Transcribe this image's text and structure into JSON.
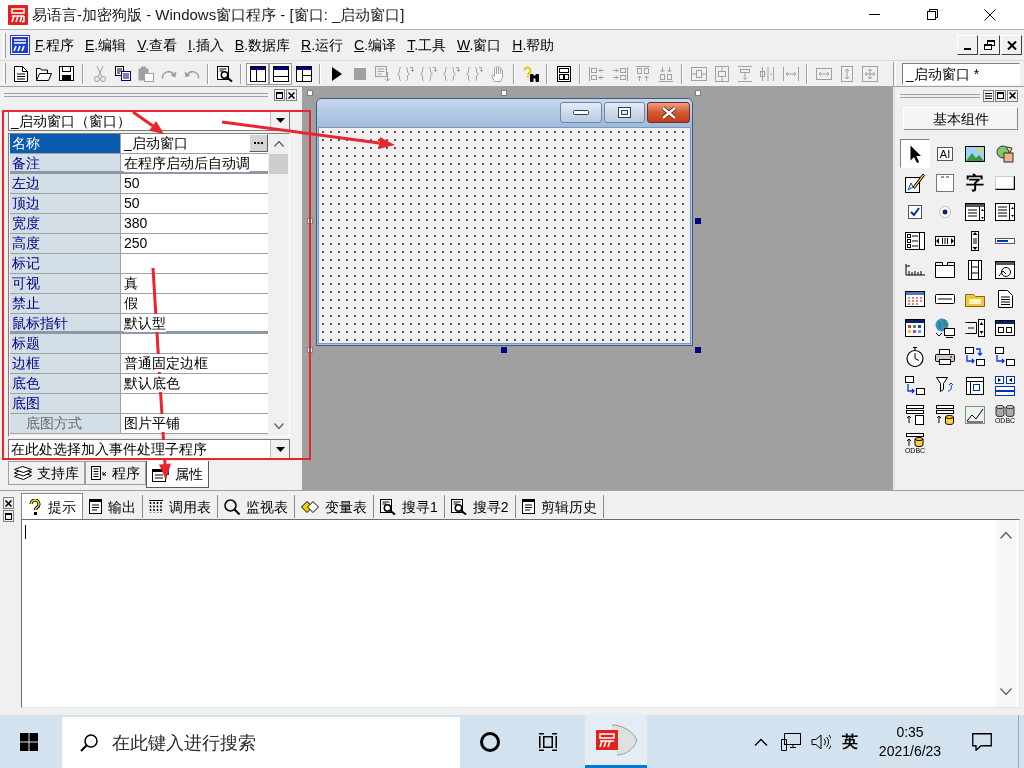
{
  "window": {
    "title": "易语言-加密狗版 - Windows窗口程序 - [窗口: _启动窗口]"
  },
  "menu": [
    {
      "key": "F",
      "text": ".程序"
    },
    {
      "key": "E",
      "text": ".编辑"
    },
    {
      "key": "V",
      "text": ".查看"
    },
    {
      "key": "I",
      "text": ".插入"
    },
    {
      "key": "B",
      "text": ".数据库"
    },
    {
      "key": "R",
      "text": ".运行"
    },
    {
      "key": "C",
      "text": ".编译"
    },
    {
      "key": "T",
      "text": ".工具"
    },
    {
      "key": "W",
      "text": ".窗口"
    },
    {
      "key": "H",
      "text": ".帮助"
    }
  ],
  "toolbar": {
    "groups": [
      {
        "items": [
          {
            "disabled": false
          },
          {
            "disabled": false
          },
          {
            "disabled": false
          }
        ]
      },
      {
        "items": [
          {
            "disabled": true
          },
          {
            "disabled": false
          },
          {
            "disabled": true
          },
          {
            "disabled": true
          },
          {
            "disabled": true
          }
        ]
      },
      {
        "items": [
          {
            "disabled": false
          }
        ]
      },
      {
        "items": [
          {
            "disabled": false,
            "pressed": true
          },
          {
            "disabled": false,
            "pressed": true
          },
          {
            "disabled": false,
            "pressed": false
          }
        ]
      },
      {
        "items": [
          {
            "disabled": false
          },
          {
            "disabled": true
          },
          {
            "disabled": true
          },
          {
            "disabled": true
          },
          {
            "disabled": true
          },
          {
            "disabled": true
          },
          {
            "disabled": true
          },
          {
            "disabled": true
          }
        ]
      },
      {
        "items": [
          {
            "disabled": false
          }
        ]
      },
      {
        "items": [
          {
            "disabled": false
          }
        ]
      },
      {
        "items": [
          {
            "disabled": true
          },
          {
            "disabled": true
          },
          {
            "disabled": true
          },
          {
            "disabled": true
          }
        ]
      },
      {
        "items": [
          {
            "disabled": true
          },
          {
            "disabled": true
          },
          {
            "disabled": true
          },
          {
            "disabled": true
          },
          {
            "disabled": true
          }
        ]
      },
      {
        "items": [
          {
            "disabled": true
          },
          {
            "disabled": true
          },
          {
            "disabled": true
          }
        ]
      }
    ],
    "object_selector": "_启动窗口 *"
  },
  "properties": {
    "object_selector": "_启动窗口（窗口）",
    "groups": [
      {
        "rows": [
          {
            "name": "名称",
            "value": "_启动窗口",
            "selected": true
          },
          {
            "name": "备注",
            "value": "在程序启动后自动调",
            "selected": false
          }
        ]
      },
      {
        "rows": [
          {
            "name": "左边",
            "value": "50",
            "selected": false
          },
          {
            "name": "顶边",
            "value": "50",
            "selected": false
          },
          {
            "name": "宽度",
            "value": "380",
            "selected": false
          },
          {
            "name": "高度",
            "value": "250",
            "selected": false
          },
          {
            "name": "标记",
            "selected": false
          },
          {
            "name": "可视",
            "value": "真",
            "selected": false
          },
          {
            "name": "禁止",
            "value": "假",
            "selected": false
          },
          {
            "name": "鼠标指针",
            "value": "默认型",
            "selected": false
          }
        ]
      },
      {
        "rows": [
          {
            "name": "标题",
            "selected": false
          },
          {
            "name": "边框",
            "value": "普通固定边框",
            "selected": false
          },
          {
            "name": "底色",
            "value": "默认底色",
            "selected": false
          },
          {
            "name": "底图",
            "selected": false,
            "children": [
              {
                "name": "底图方式",
                "value": "图片平铺",
                "selected": false
              }
            ]
          }
        ]
      }
    ],
    "event_selector": "在此处选择加入事件处理子程序",
    "tabs": [
      {
        "label": "支持库",
        "selected": false
      },
      {
        "label": "程序",
        "selected": false
      },
      {
        "label": "属性",
        "selected": true
      }
    ]
  },
  "toolbox": {
    "category": "基本组件",
    "items": [
      {
        "selected": true
      },
      {
        "selected": false,
        "glyph": "AI"
      },
      {
        "selected": false
      },
      {
        "selected": false
      },
      {
        "selected": false
      },
      {
        "selected": false
      },
      {
        "selected": false,
        "glyph": "字"
      },
      {
        "selected": false
      },
      {
        "selected": false
      },
      {
        "selected": false
      },
      {
        "selected": false
      },
      {
        "selected": false
      },
      {
        "selected": false
      },
      {
        "selected": false
      },
      {
        "selected": false
      },
      {
        "selected": false
      },
      {
        "selected": false
      },
      {
        "selected": false
      },
      {
        "selected": false
      },
      {
        "selected": false
      },
      {
        "selected": false
      },
      {
        "selected": false
      },
      {
        "selected": false
      },
      {
        "selected": false
      },
      {
        "selected": false
      },
      {
        "selected": false
      },
      {
        "selected": false
      },
      {
        "selected": false
      },
      {
        "selected": false
      },
      {
        "selected": false
      },
      {
        "selected": false
      },
      {
        "selected": false
      },
      {
        "selected": false
      },
      {
        "selected": false
      },
      {
        "selected": false
      },
      {
        "selected": false
      },
      {
        "selected": false
      },
      {
        "selected": false
      },
      {
        "selected": false
      },
      {
        "selected": false,
        "caption": "ODBC"
      },
      {
        "selected": false,
        "caption": "ODBC"
      }
    ]
  },
  "output": {
    "tabs": [
      {
        "label": "提示",
        "selected": true
      },
      {
        "label": "输出",
        "selected": false
      },
      {
        "label": "调用表",
        "selected": false
      },
      {
        "label": "监视表",
        "selected": false
      },
      {
        "label": "变量表",
        "selected": false
      },
      {
        "label": "搜寻1",
        "selected": false
      },
      {
        "label": "搜寻2",
        "selected": false
      },
      {
        "label": "剪辑历史",
        "selected": false
      }
    ]
  },
  "taskbar": {
    "search_placeholder": "在此键入进行搜索",
    "apps": [
      {
        "active": true
      }
    ],
    "input_language": "英",
    "time": "0:35",
    "date": "2021/6/23"
  }
}
